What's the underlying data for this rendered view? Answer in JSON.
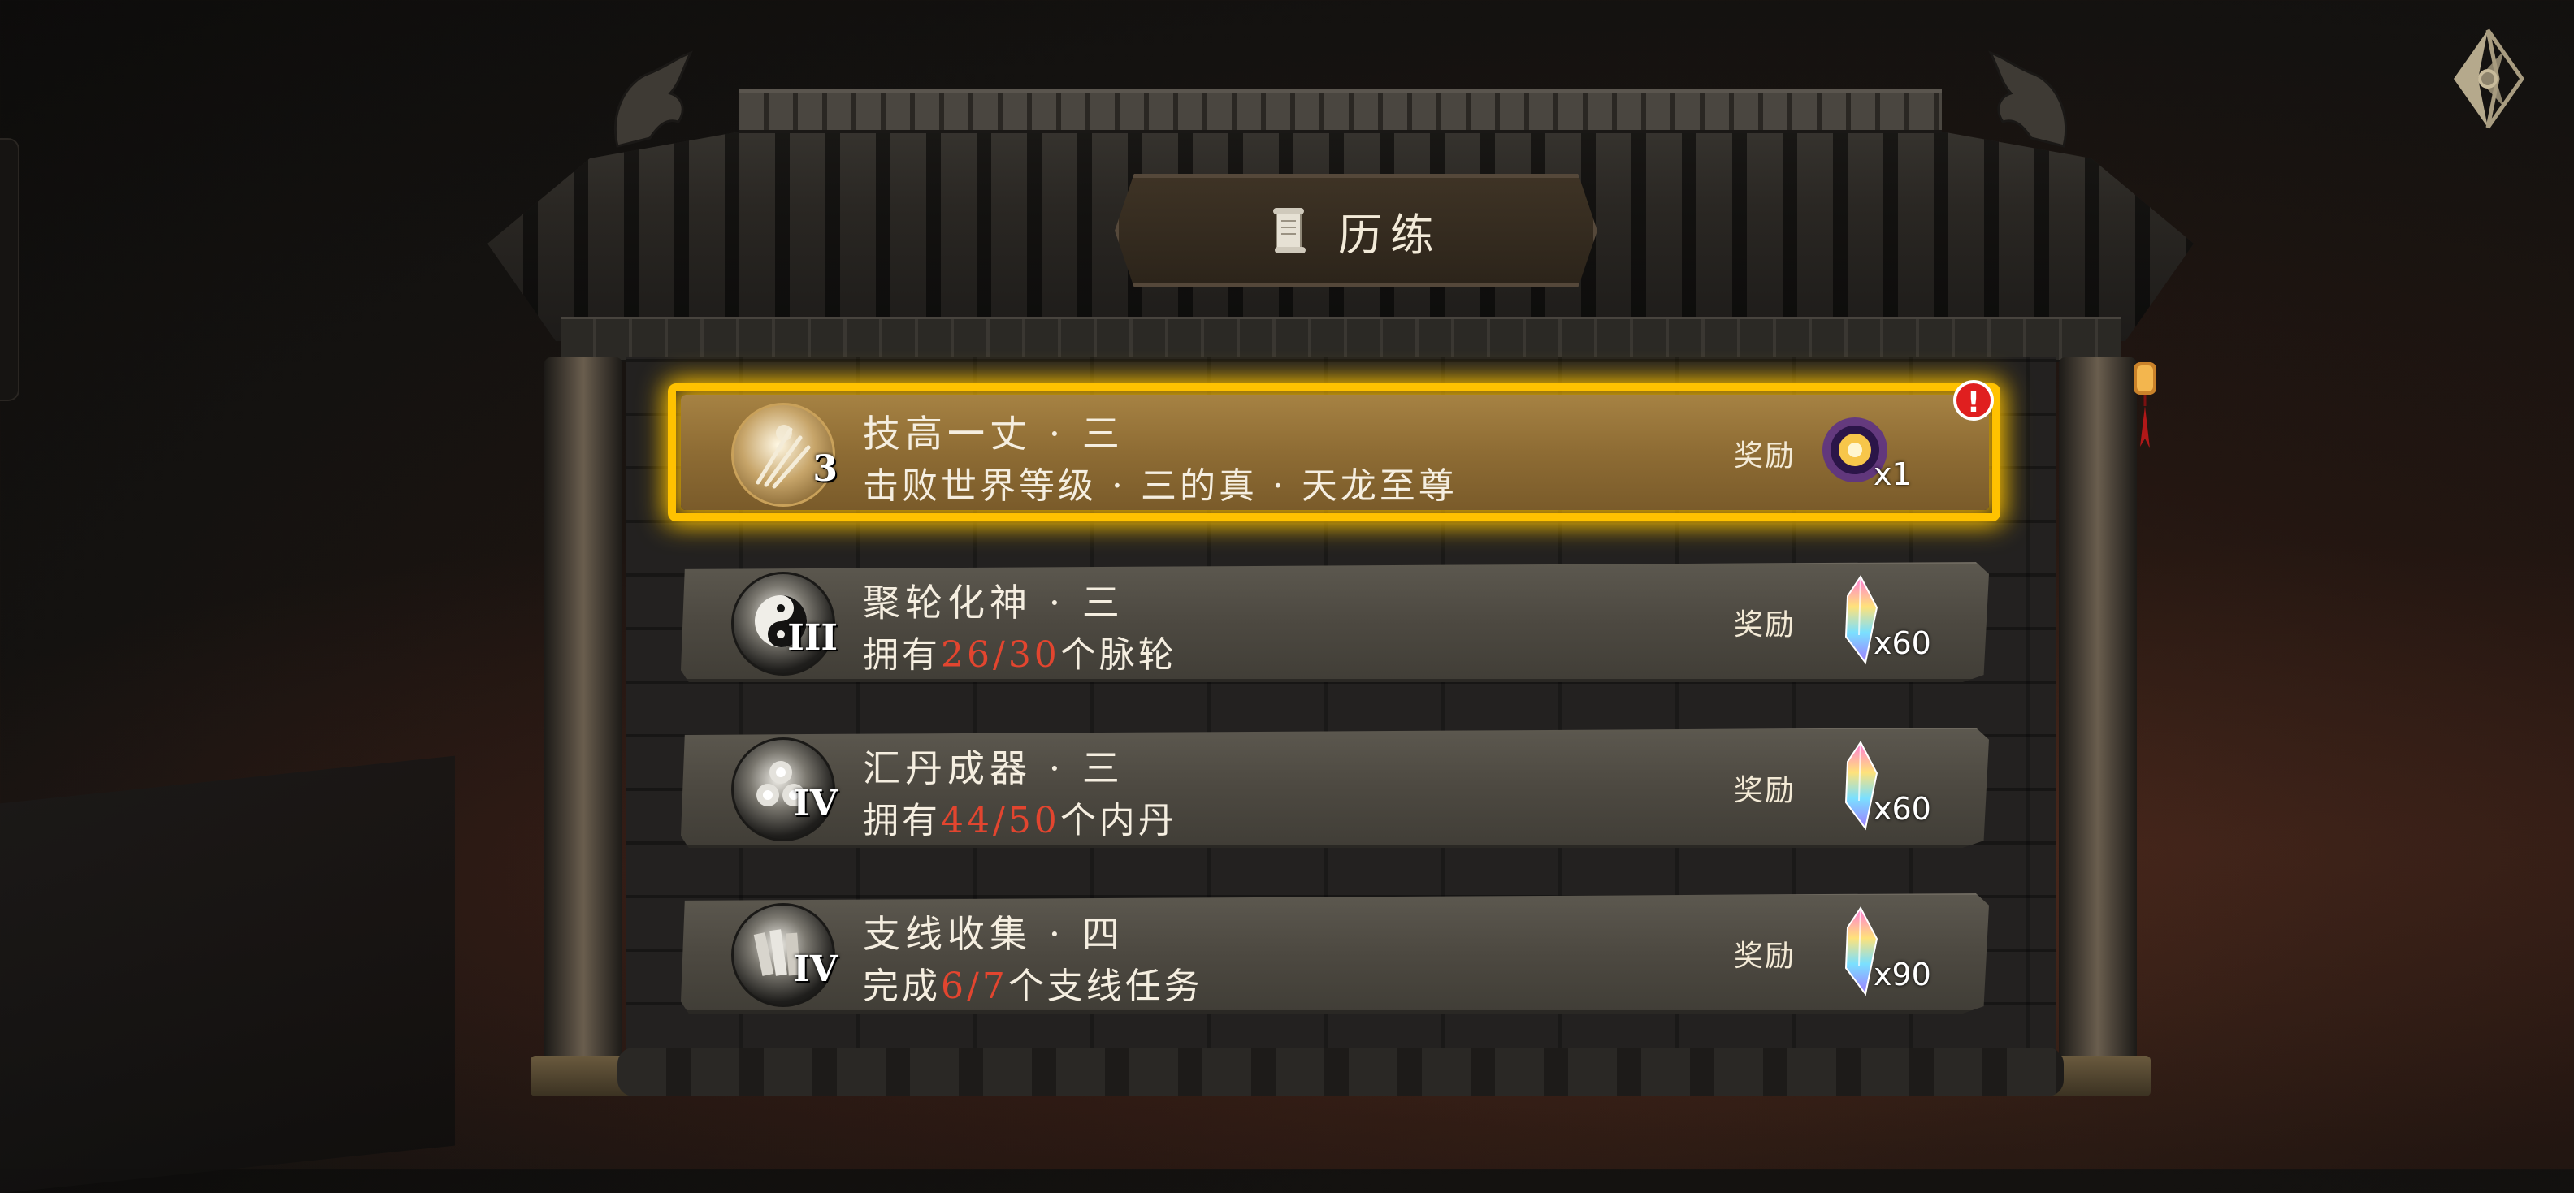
{
  "title": "历练",
  "back_icon": "diamond-back-arrow-icon",
  "reward_label": "奖励",
  "quests": [
    {
      "icon": "sword-slash-icon",
      "badge_text": "3",
      "title": "技高一丈 · 三",
      "desc": "击败世界等级 · 三的真 · 天龙至尊",
      "reward_icon": "golden-orb-icon",
      "reward_qty": "x1",
      "active": true,
      "alert": "!"
    },
    {
      "icon": "yin-yang-icon",
      "badge_text": "III",
      "title": "聚轮化神 · 三",
      "desc_prefix": "拥有",
      "progress": "26/30",
      "desc_suffix": "个脉轮",
      "reward_icon": "rainbow-crystal-icon",
      "reward_qty": "x60"
    },
    {
      "icon": "triple-orb-icon",
      "badge_text": "IV",
      "title": "汇丹成器 · 三",
      "desc_prefix": "拥有",
      "progress": "44/50",
      "desc_suffix": "个内丹",
      "reward_icon": "rainbow-crystal-icon",
      "reward_qty": "x60"
    },
    {
      "icon": "scroll-books-icon",
      "badge_text": "IV",
      "title": "支线收集 · 四",
      "desc_prefix": "完成",
      "progress": "6/7",
      "desc_suffix": "个支线任务",
      "reward_icon": "rainbow-crystal-icon",
      "reward_qty": "x90"
    }
  ],
  "colors": {
    "highlight": "#ffc400",
    "progress_red": "#e2452f",
    "alert_red": "#e01f1f"
  }
}
